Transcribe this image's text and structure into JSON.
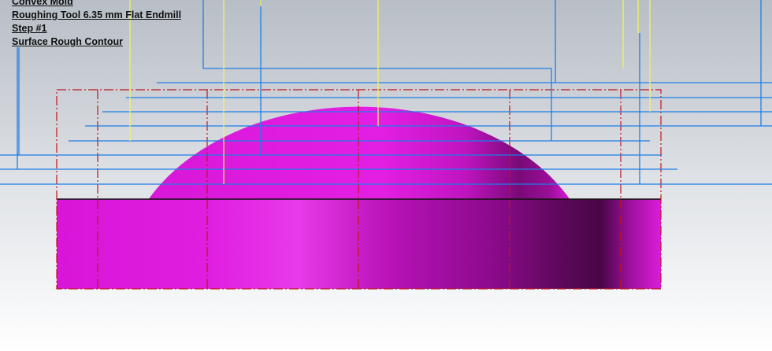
{
  "viewport": {
    "background_top": "#b9bfc7",
    "background_bottom": "#ffffff"
  },
  "info": {
    "part_name": "Convex Mold",
    "tool": "Roughing Tool 6.35 mm Flat Endmill",
    "step": "Step #1",
    "operation": "Surface Rough Contour"
  },
  "colors": {
    "part_magenta": "#e21be2",
    "part_shadow": "#4a0848",
    "toolpath_blue": "#1e7de6",
    "tool_axis_yellow": "#f2f25a",
    "boundary_red": "#c0141c",
    "base_top_edge": "#111111"
  }
}
